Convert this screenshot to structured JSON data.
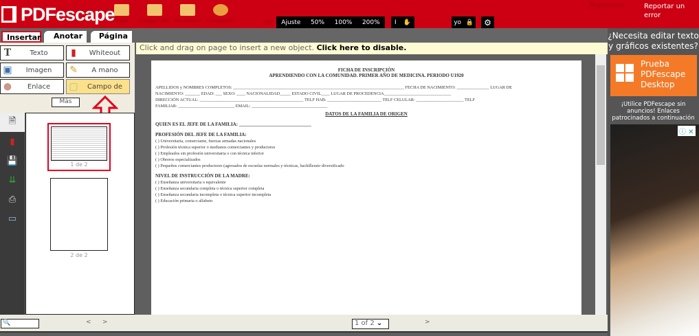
{
  "header": {
    "logo": "PDFescape",
    "toolbar": [
      {
        "label": "Subir",
        "icon": "upload-folder-icon"
      },
      {
        "label": "Cargar URL",
        "icon": "url-folder-icon"
      },
      {
        "label": "Recientes",
        "icon": "recent-folder-icon"
      },
      {
        "label": "Compartir",
        "icon": "share-icon"
      }
    ],
    "view_label": "Ver",
    "zoom": [
      "Ajuste",
      "50%",
      "100%",
      "200%"
    ],
    "lock_label": "yo",
    "register": "Registrarse",
    "report": "Reportar un error"
  },
  "tabs": [
    "Insertar",
    "Anotar",
    "Página"
  ],
  "tools": [
    "Texto",
    "Whiteout",
    "Imagen",
    "A mano",
    "Enlace",
    "Campo de"
  ],
  "more": "Más",
  "thumbnails": [
    "1 de 2",
    "2 de 2"
  ],
  "hint": {
    "text": "Click and drag on page to insert a new object.",
    "action": "Click here to disable."
  },
  "doc": {
    "title": "FICHA DE INSCRIPCIÓN",
    "subtitle": "APRENDIENDO CON LA COMUNIDAD. PRIMER AÑO DE MEDICINA. PERIODO U1920",
    "lines": [
      "APELLIDOS y NOMBRES COMPLETOS: _______________________________________________________________________________ FECHA DE NACIMIENTO: _______________ LUGAR DE",
      "NACIMIENTO: _______    EDAD: ___   SEXO: ____   NACIONALIDAD_____ ESTADO CIVIL____    LUGAR DE PROCEDENCIA_______________________________",
      "DIRECCIÓN ACTUAL: ________________________________________________ TELF HAB: _________________________    TELF CELULAR: ______________________     TELF",
      "FAMILIAR: __________________________     EMAIL: ___________________________________"
    ],
    "section": "DATOS DE LA FAMILIA DE ORIGEN",
    "jefe": "QUIEN ES EL JEFE DE LA FAMILIA: ______________________________",
    "prof_title": "PROFESIÓN DEL JEFE DE LA FAMILIA:",
    "prof": [
      "(  )       Universitaria, comerciante, fuerzas armadas nacionales",
      "(  )       Profesión técnica superior o medianos comerciantes y productores",
      "(  )    Empleados sin profesión universitaria o con técnica inferior",
      "(  )    Obreros especializados",
      "(  )       Pequeños comerciantes productores (agresados de escuelas normales y técnicas, bachillerato   diversificado"
    ],
    "madre_title": "NIVEL DE INSTRUCCIÓN DE LA MADRE:",
    "madre": [
      "(  )       Enseñanza universitaria o equivalente",
      "(  )       Enseñanza secundaria completa o técnica superior completa",
      "(  )       Enseñanza secundaria incompleta o técnica superior incompleta",
      "(  )       Educación primaria o alfabeto"
    ]
  },
  "bottom": {
    "prev": "<",
    "next": ">",
    "page_select": "1 of 2",
    "page_next": ">"
  },
  "ad": {
    "question": "¿Necesita editar texto y gráficos existentes?",
    "cta": "Prueba PDFescape Desktop",
    "note": "¡Utilice PDFescape sin anuncios! Enlaces patrocinados a continuación"
  },
  "colors": {
    "brand": "#cc0012",
    "accent": "#f47a28",
    "highlight": "#fde08a",
    "annotation": "#e3001b"
  }
}
